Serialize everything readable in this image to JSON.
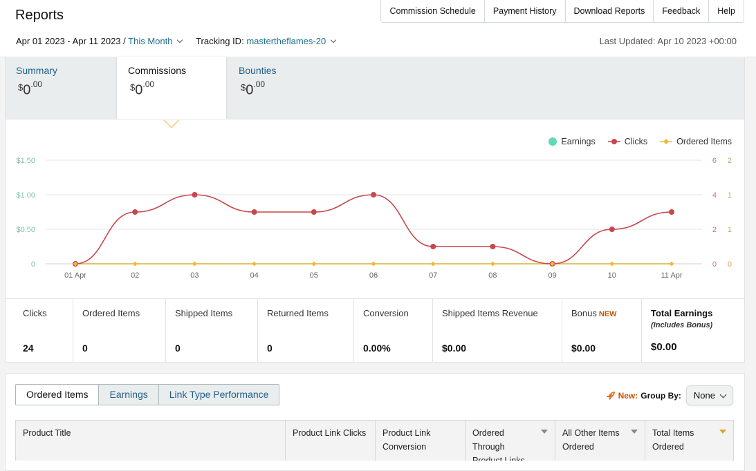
{
  "header": {
    "title": "Reports",
    "nav": [
      "Commission Schedule",
      "Payment History",
      "Download Reports",
      "Feedback",
      "Help"
    ]
  },
  "filters": {
    "date_range": "Apr 01 2023 - Apr 11 2023 /",
    "period": "This Month",
    "tracking_label": "Tracking ID:",
    "tracking_id": "mastertheflames-20",
    "last_updated": "Last Updated: Apr 10 2023 +00:00"
  },
  "summary_tabs": [
    {
      "label": "Summary",
      "currency": "$",
      "amount": "0",
      "cents": ".00"
    },
    {
      "label": "Commissions",
      "currency": "$",
      "amount": "0",
      "cents": ".00"
    },
    {
      "label": "Bounties",
      "currency": "$",
      "amount": "0",
      "cents": ".00"
    }
  ],
  "legend": {
    "earnings": "Earnings",
    "clicks": "Clicks",
    "ordered": "Ordered Items"
  },
  "colors": {
    "earnings": "#5fd9b6",
    "clicks": "#c9464c",
    "ordered": "#f0b93a",
    "link": "#1d5f8c",
    "new": "#c45500"
  },
  "chart_data": {
    "type": "line",
    "categories": [
      "01 Apr",
      "02",
      "03",
      "04",
      "05",
      "06",
      "07",
      "08",
      "09",
      "10",
      "11 Apr"
    ],
    "series": [
      {
        "name": "Earnings",
        "values": [
          0,
          0,
          0,
          0,
          0,
          0,
          0,
          0,
          0,
          0,
          0
        ]
      },
      {
        "name": "Clicks",
        "values": [
          0,
          3,
          4,
          3,
          3,
          4,
          1,
          1,
          0,
          2,
          3
        ]
      },
      {
        "name": "Ordered Items",
        "values": [
          0,
          0,
          0,
          0,
          0,
          0,
          0,
          0,
          0,
          0,
          0
        ]
      }
    ],
    "left_axis": {
      "ticks": [
        "0",
        "$0.50",
        "$1.00",
        "$1.50"
      ],
      "range": [
        0,
        1.5
      ]
    },
    "right_axis_clicks": {
      "ticks": [
        "0",
        "2",
        "4",
        "6"
      ],
      "range": [
        0,
        6
      ]
    },
    "right_axis_ordered": {
      "ticks": [
        "0",
        "1",
        "1",
        "2"
      ],
      "range": [
        0,
        2
      ]
    },
    "grid": true,
    "legend_position": "top-right"
  },
  "stats": [
    {
      "label": "Clicks",
      "value": "24"
    },
    {
      "label": "Ordered Items",
      "value": "0"
    },
    {
      "label": "Shipped Items",
      "value": "0"
    },
    {
      "label": "Returned Items",
      "value": "0"
    },
    {
      "label": "Conversion",
      "value": "0.00%"
    },
    {
      "label": "Shipped Items Revenue",
      "value": "$0.00"
    },
    {
      "label": "Bonus",
      "badge": "NEW",
      "value": "$0.00"
    },
    {
      "label": "Total Earnings",
      "sublabel": "(Includes Bonus)",
      "value": "$0.00"
    }
  ],
  "report_tabs": [
    "Ordered Items",
    "Earnings",
    "Link Type Performance"
  ],
  "group_by": {
    "new_label": "New:",
    "label": "Group By:",
    "selected": "None"
  },
  "table_headers": [
    "Product Title",
    "Product Link Clicks",
    "Product Link Conversion",
    "Ordered Through Product Links",
    "All Other Items Ordered",
    "Total Items Ordered"
  ]
}
